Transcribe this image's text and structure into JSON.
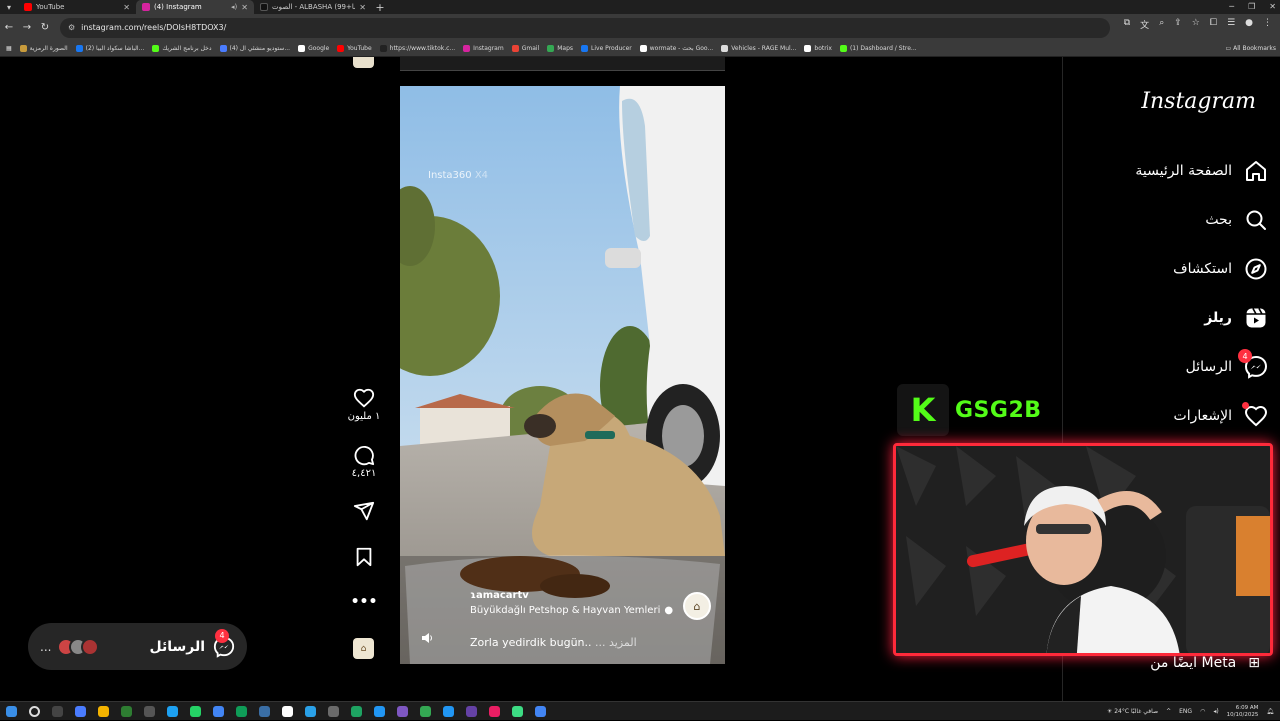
{
  "browser": {
    "tabs": [
      {
        "title": "YouTube",
        "color": "#ff0000",
        "active": false
      },
      {
        "title": "(4) Instagram",
        "color": "#d6249f",
        "active": true
      },
      {
        "title": "الصوت - ALBASHA (الباشا+99)",
        "color": "#111111",
        "active": false
      }
    ],
    "url": "instagram.com/reels/DOIsH8TDOX3/",
    "bookmarks": [
      {
        "label": "الصورة الرمزية",
        "color": "#c89b3c"
      },
      {
        "label": "(2) الباشا سكواد البيا...",
        "color": "#1877f2"
      },
      {
        "label": "دخل برنامج الشريك",
        "color": "#53fc18"
      },
      {
        "label": "(4) ستوديو منشئي ال...",
        "color": "#4a7cff"
      },
      {
        "label": "Google",
        "color": "#ffffff"
      },
      {
        "label": "YouTube",
        "color": "#ff0000"
      },
      {
        "label": "https://www.tiktok.c...",
        "color": "#222222"
      },
      {
        "label": "Instagram",
        "color": "#d6249f"
      },
      {
        "label": "Gmail",
        "color": "#ea4335"
      },
      {
        "label": "Maps",
        "color": "#34a853"
      },
      {
        "label": "Live Producer",
        "color": "#1877f2"
      },
      {
        "label": "wormate - بحث Goo...",
        "color": "#ffffff"
      },
      {
        "label": "Vehicles - RAGE Mul...",
        "color": "#dddddd"
      },
      {
        "label": "botrix",
        "color": "#ffffff"
      },
      {
        "label": "(1) Dashboard / Stre...",
        "color": "#53fc18"
      }
    ],
    "all_bookmarks": "All Bookmarks"
  },
  "reel": {
    "watermark": "Insta360",
    "watermark_suffix": "X4",
    "username": "ɿamacartv",
    "shop": "Büyükdağlı Petshop & Hayvan Yemleri",
    "caption": "Zorla yedirdik bugün..",
    "more": "... المزيد",
    "likes": "١ مليون",
    "comments": "٤,٤٢١"
  },
  "messages_pill": {
    "label": "الرسائل",
    "badge": "4",
    "dots": "..."
  },
  "sidebar": {
    "logo": "Instagram",
    "items": [
      {
        "label": "الصفحة الرئيسية",
        "icon": "home-icon"
      },
      {
        "label": "بحث",
        "icon": "search-icon"
      },
      {
        "label": "استكشاف",
        "icon": "compass-icon"
      },
      {
        "label": "ريلز",
        "icon": "reels-icon"
      },
      {
        "label": "الرسائل",
        "icon": "messenger-icon",
        "badge": "4"
      },
      {
        "label": "الإشعارات",
        "icon": "heart-icon"
      }
    ],
    "also_meta": "ايضًا من Meta"
  },
  "overlay": {
    "kick_letter": "K",
    "channel": "GSG2B",
    "accent": "#53fc18",
    "frame": "#ff2a3a"
  },
  "taskbar": {
    "weather": "24°C",
    "weather_text": "صافي غالبًا",
    "lang": "ENG",
    "time": "6:09 AM",
    "date": "10/10/2025"
  }
}
